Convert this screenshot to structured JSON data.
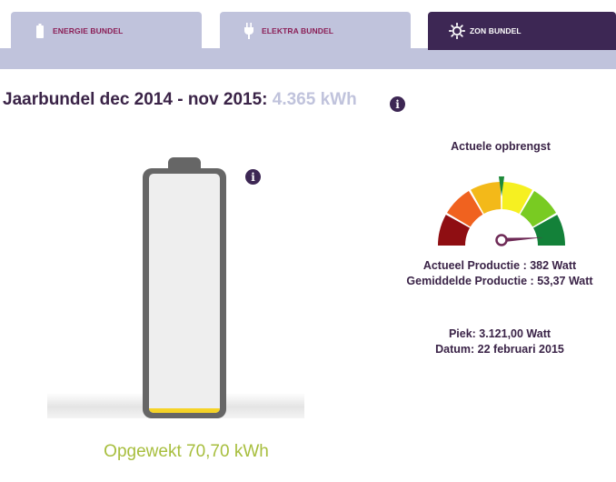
{
  "tabs": [
    {
      "label": "ENERGIE BUNDEL",
      "icon": "battery-icon",
      "active": false
    },
    {
      "label": "ELEKTRA BUNDEL",
      "icon": "plug-icon",
      "active": false
    },
    {
      "label": "ZON BUNDEL",
      "icon": "sun-icon",
      "active": true
    }
  ],
  "heading": {
    "title": "Jaarbundel dec 2014 - nov 2015:",
    "value": "4.365 kWh"
  },
  "battery": {
    "level_fraction": 0.016,
    "opgewekt": "Opgewekt 70,70 kWh"
  },
  "gauge": {
    "title": "Actuele opbrengst",
    "needle_fraction": 0.98,
    "marker_fraction": 0.5,
    "segment_colors": [
      "#8f0e12",
      "#f0621f",
      "#f3b919",
      "#f6f021",
      "#79cb22",
      "#138139"
    ],
    "actueel": "Actueel Productie : 382 Watt",
    "gemiddeld": "Gemiddelde Productie : 53,37 Watt",
    "piek": "Piek: 3.121,00 Watt",
    "datum": "Datum: 22 februari 2015"
  },
  "colors": {
    "accent_dark": "#3d2754",
    "tab_inactive": "#c0c3dc",
    "tab_text": "#8a1d55",
    "generated_green": "#a7be3d",
    "battery_fill": "#f5d327"
  }
}
